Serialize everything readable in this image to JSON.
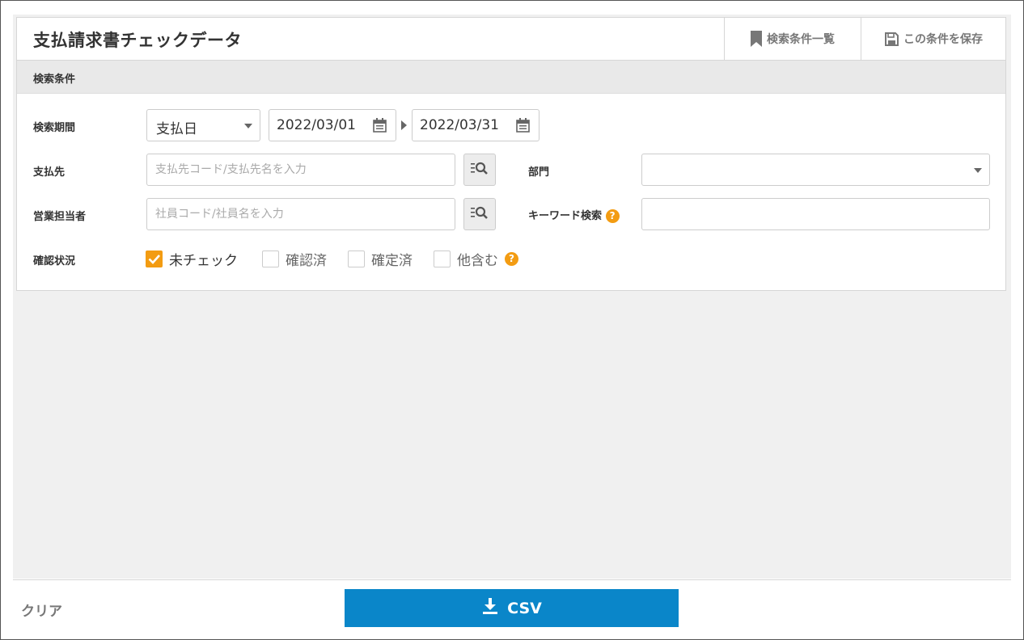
{
  "header": {
    "title": "支払請求書チェックデータ",
    "saved_searches_label": "検索条件一覧",
    "save_condition_label": "この条件を保存"
  },
  "search": {
    "section_title": "検索条件",
    "period": {
      "label": "検索期間",
      "date_type_selected": "支払日",
      "from": "2022/03/01",
      "to": "2022/03/31"
    },
    "payee": {
      "label": "支払先",
      "placeholder": "支払先コード/支払先名を入力",
      "value": ""
    },
    "department": {
      "label": "部門",
      "selected": ""
    },
    "sales_rep": {
      "label": "営業担当者",
      "placeholder": "社員コード/社員名を入力",
      "value": ""
    },
    "keyword": {
      "label": "キーワード検索",
      "help": "?",
      "value": ""
    },
    "status": {
      "label": "確認状況",
      "options": [
        {
          "label": "未チェック",
          "checked": true
        },
        {
          "label": "確認済",
          "checked": false
        },
        {
          "label": "確定済",
          "checked": false
        },
        {
          "label": "他含む",
          "checked": false
        }
      ],
      "help": "?"
    }
  },
  "footer": {
    "clear_label": "クリア",
    "csv_label": "CSV"
  },
  "colors": {
    "accent_orange": "#f39c12",
    "primary_blue": "#0a86c9"
  },
  "icons": {
    "saved_searches": "bookmark-icon",
    "save_condition": "save-icon",
    "calendar": "calendar-icon",
    "lookup": "list-search-icon",
    "download": "download-icon"
  }
}
